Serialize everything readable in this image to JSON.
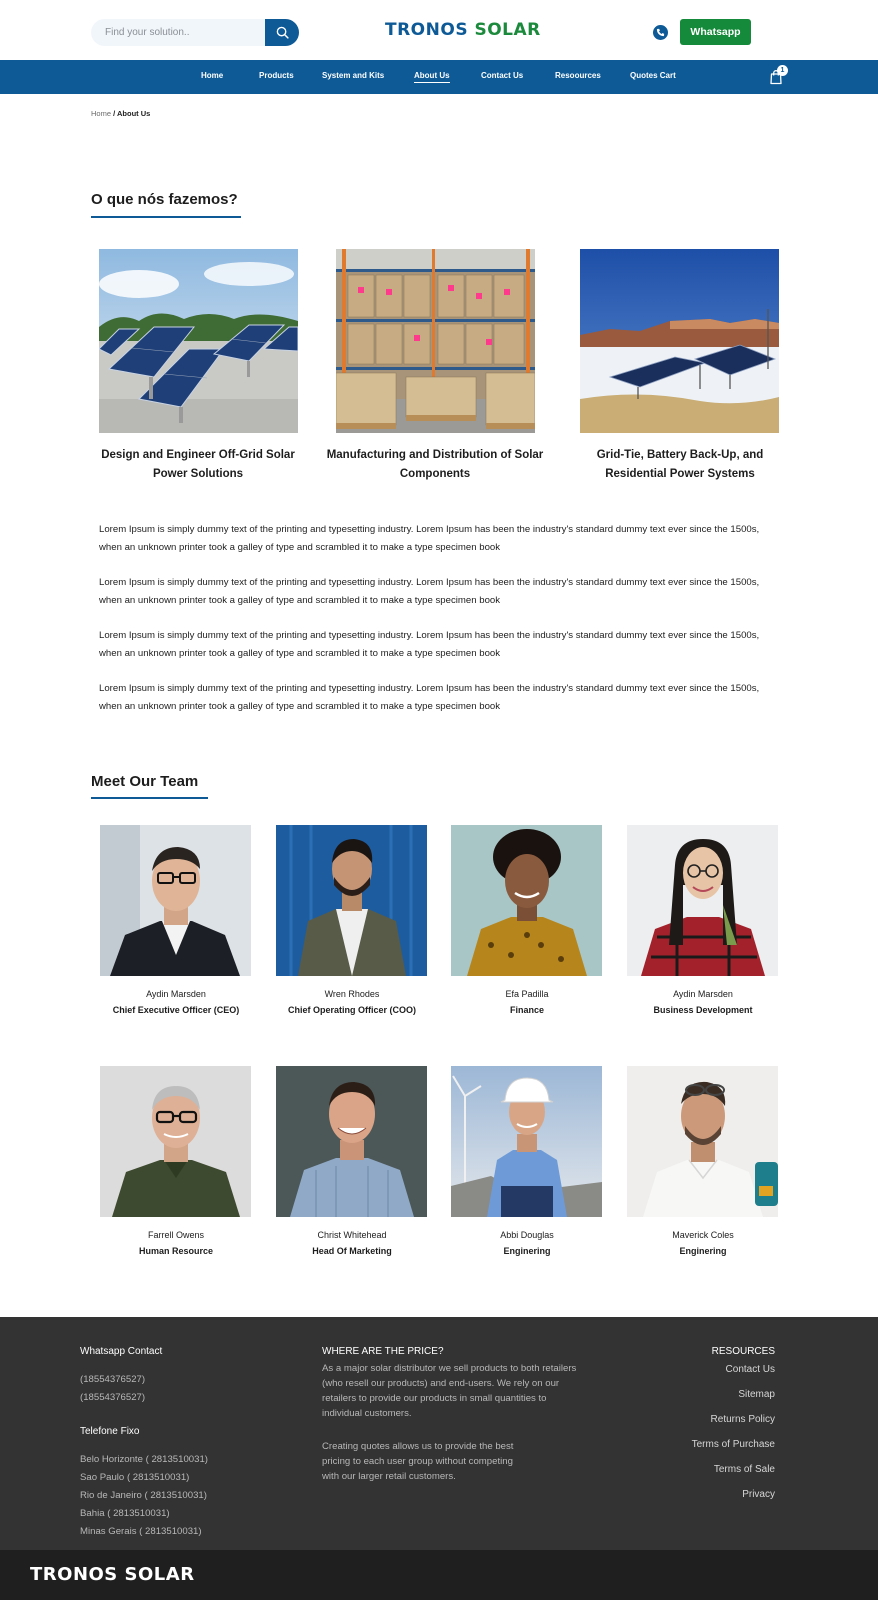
{
  "header": {
    "search_placeholder": "Find your solution..",
    "brand_part1": "TRONOS",
    "brand_part2": "SOLAR",
    "whatsapp_label": "Whatsapp"
  },
  "nav": {
    "items": [
      "Home",
      "Products",
      "System and Kits",
      "About Us",
      "Contact Us",
      "Resoources",
      "Quotes Cart"
    ],
    "active": "About Us",
    "cart_count": "1"
  },
  "breadcrumb": {
    "home": "Home",
    "current": "/ About Us"
  },
  "what_we_do": {
    "title": "O que nós fazemos?",
    "cards": [
      {
        "caption": "Design and Engineer Off-Grid Solar Power Solutions"
      },
      {
        "caption": "Manufacturing and Distribution of Solar Components"
      },
      {
        "caption": "Grid-Tie, Battery Back-Up, and Residential Power Systems"
      }
    ]
  },
  "paragraphs": [
    "Lorem Ipsum is simply dummy text of the printing and typesetting industry. Lorem Ipsum has been the industry's standard dummy text ever since the 1500s, when an unknown printer took a galley of type and scrambled it to make a type specimen book",
    "Lorem Ipsum is simply dummy text of the printing and typesetting industry. Lorem Ipsum has been the industry's standard dummy text ever since the 1500s, when an unknown printer took a galley of type and scrambled it to make a type specimen book",
    "Lorem Ipsum is simply dummy text of the printing and typesetting industry. Lorem Ipsum has been the industry's standard dummy text ever since the 1500s, when an unknown printer took a galley of type and scrambled it to make a type specimen book",
    "Lorem Ipsum is simply dummy text of the printing and typesetting industry. Lorem Ipsum has been the industry's standard dummy text ever since the 1500s, when an unknown printer took a galley of type and scrambled it to make a type specimen book"
  ],
  "team": {
    "title": "Meet Our Team",
    "members": [
      {
        "name": "Aydin Marsden",
        "role": "Chief Executive Officer (CEO)"
      },
      {
        "name": "Wren Rhodes",
        "role": "Chief Operating Officer (COO)"
      },
      {
        "name": "Efa Padilla",
        "role": "Finance"
      },
      {
        "name": "Aydin Marsden",
        "role": "Business Development"
      },
      {
        "name": "Farrell Owens",
        "role": "Human Resource"
      },
      {
        "name": "Christ Whitehead",
        "role": "Head Of Marketing"
      },
      {
        "name": "Abbi Douglas",
        "role": "Enginering"
      },
      {
        "name": "Maverick Coles",
        "role": "Enginering"
      }
    ]
  },
  "footer": {
    "whatsapp_title": "Whatsapp Contact",
    "whatsapp_numbers": [
      " (18554376527)",
      " (18554376527)"
    ],
    "landline_title": "Telefone Fixo",
    "landlines": [
      "Belo Horizonte ( 2813510031)",
      "Sao Paulo ( 2813510031)",
      "Rio de Janeiro ( 2813510031)",
      "Bahia ( 2813510031)",
      "Minas Gerais ( 2813510031)"
    ],
    "price_title": "WHERE ARE THE PRICE?",
    "price_text1": "As a major solar distributor we sell products to both retailers (who resell our products) and end-users. We rely on our retailers to provide our products in small quantities to individual customers.",
    "price_text2": "Creating quotes allows us to provide the best pricing to each user group without competing with our larger retail customers.",
    "resources_title": "RESOURCES",
    "resources_links": [
      "Contact Us",
      "Sitemap",
      "Returns Policy",
      "Terms of Purchase",
      "Terms of Sale",
      "Privacy"
    ],
    "bottom_logo": "TRONOS SOLAR"
  },
  "colors": {
    "primary": "#0d5a97",
    "accent_green": "#148a3a",
    "footer_bg": "#333333",
    "bottom_bg": "#1f1f1f"
  }
}
